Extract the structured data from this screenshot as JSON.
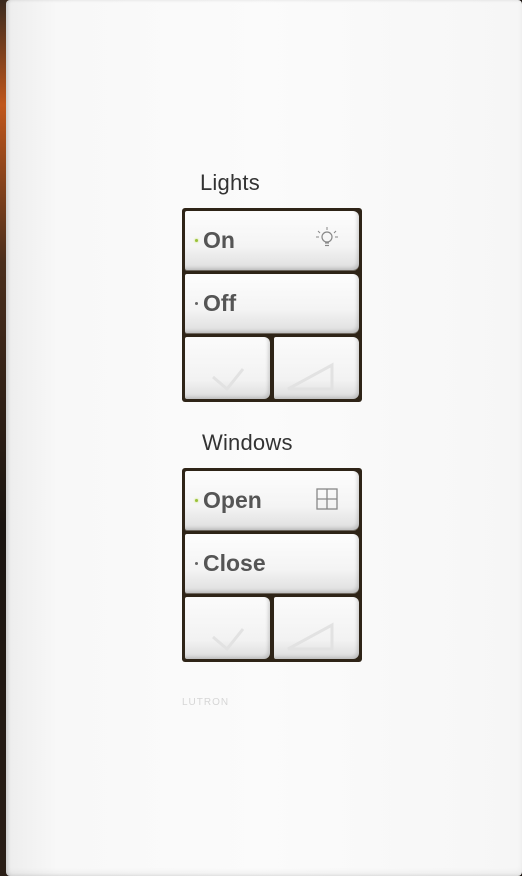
{
  "groups": [
    {
      "label": "Lights",
      "buttons": [
        {
          "label": "On",
          "led": "active",
          "icon": "lightbulb-icon"
        },
        {
          "label": "Off",
          "led": "inactive"
        }
      ],
      "rockers": [
        "lower-icon",
        "raise-icon"
      ]
    },
    {
      "label": "Windows",
      "buttons": [
        {
          "label": "Open",
          "led": "active",
          "icon": "window-icon"
        },
        {
          "label": "Close",
          "led": "inactive"
        }
      ],
      "rockers": [
        "lower-icon",
        "raise-icon"
      ]
    }
  ],
  "brand": "LUTRON",
  "colors": {
    "led_active": "#9bc13a",
    "led_inactive": "#666666",
    "bank_frame": "#2e2417",
    "plate": "#f8f8f8"
  }
}
